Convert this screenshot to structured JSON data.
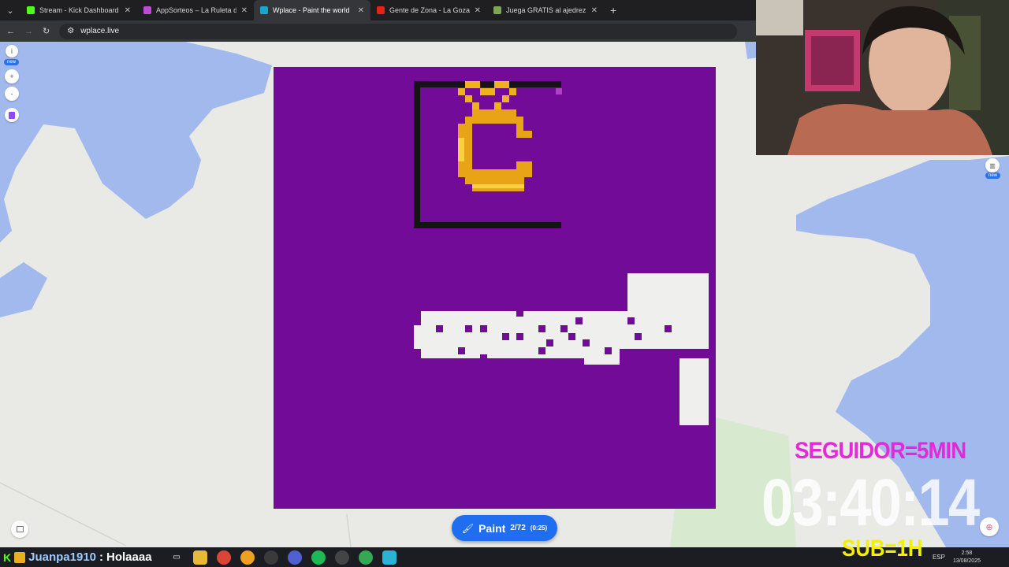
{
  "browser": {
    "tabs": [
      {
        "title": "Stream - Kick Dashboard",
        "color": "#53fc18",
        "active": false
      },
      {
        "title": "AppSorteos – La Ruleta de la Suerte",
        "color": "#c04ad8",
        "active": false
      },
      {
        "title": "Wplace - Paint the world",
        "color": "#1aa6c8",
        "active": true
      },
      {
        "title": "Gente de Zona - La Gozadera",
        "color": "#e62117",
        "active": false
      },
      {
        "title": "Juega GRATIS al ajedrez online",
        "color": "#7fa650",
        "active": false
      }
    ],
    "close_glyph": "✕",
    "new_tab_glyph": "+",
    "url": "wplace.live"
  },
  "map": {
    "left_controls": {
      "info_glyph": "i",
      "new_badge": "new",
      "zoom_in": "+",
      "zoom_out": "-"
    },
    "right_badge": "new",
    "canvas_bg": "#720b98",
    "paint_button": {
      "label": "Paint",
      "count": "2/72",
      "timer": "(0:25)"
    }
  },
  "overlay": {
    "seguidor": "SEGUIDOR=5MIN",
    "timer": "03:40:14",
    "subs": "SUB=1H"
  },
  "chat": {
    "username": "Juanpa1910",
    "separator": ":",
    "message": "Holaaaa"
  },
  "tray": {
    "lang": "ESP",
    "time": "2:58",
    "date": "13/08/2025"
  }
}
